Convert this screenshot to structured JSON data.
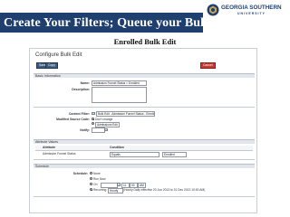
{
  "slide": {
    "title": "Create Your Filters; Queue your Bulk Edit",
    "subtitle": "Enrolled Bulk Edit",
    "logo": {
      "name": "GEORGIA SOUTHERN",
      "tagline": "UNIVERSITY",
      "colors": {
        "navy": "#1f3f6e",
        "gold": "#c8a45b"
      }
    }
  },
  "app": {
    "page_title": "Configure Bulk Edit",
    "toolbar": {
      "save_label": "Save",
      "copy_label": "Copy",
      "cancel_label": "Cancel"
    },
    "basic_info": {
      "section_label": "Basic Information",
      "name_label": "Name:",
      "name_value": "Admission Funnel Status = Enrolled",
      "description_label": "Description:",
      "description_value": ""
    },
    "filter": {
      "content_filter_label": "Content Filter:",
      "content_filter_value": "Bulk Edit - Admission Funnel Status - Enrolled",
      "modified_source_label": "Modified Source Code:",
      "modified_source_option1": "Don't change",
      "modified_source_option2": "Admissions Edit",
      "notify_label": "Notify:"
    },
    "attribute_values": {
      "section_label": "Attribute Values",
      "columns": [
        "Attribute",
        "Condition"
      ],
      "row": {
        "attribute": "Admission Funnel Status",
        "condition": "Equals",
        "value": "Enrolled"
      }
    },
    "schedule": {
      "section_label": "Schedule",
      "schedule_label": "Schedule:",
      "options": [
        "None",
        "Run Now",
        "On",
        "Recurring"
      ],
      "on_time": "11",
      "on_minute": "00",
      "on_ampm": "AM",
      "recurring_value": "Hourly",
      "recurring_text": "(Hourly Daily effective 20 Jun 2013 to 31 Dec 2013 10:00 AM)"
    }
  }
}
